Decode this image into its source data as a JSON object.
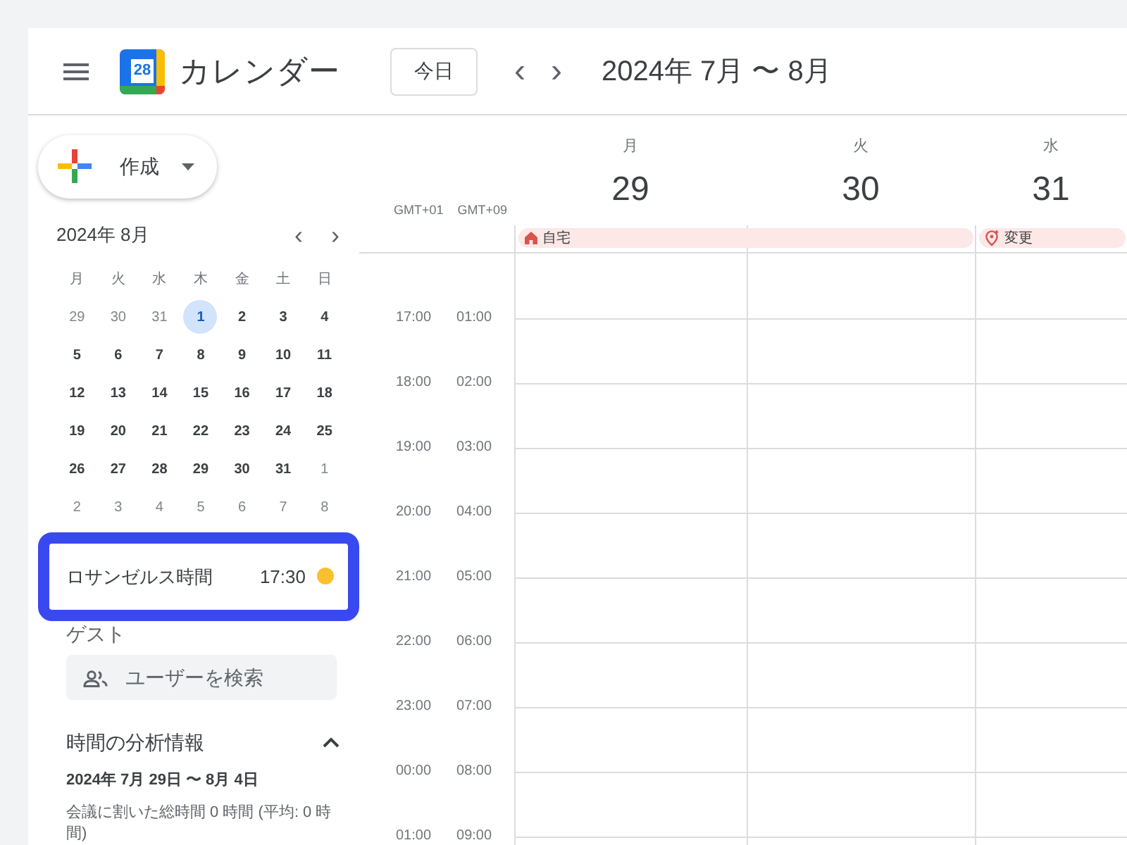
{
  "header": {
    "logo_date": "28",
    "title": "カレンダー",
    "today_button": "今日",
    "prev": "‹",
    "next": "›",
    "date_range": "2024年 7月 〜 8月"
  },
  "create_button": {
    "label": "作成"
  },
  "mini_calendar": {
    "title": "2024年 8月",
    "weekdays": [
      "月",
      "火",
      "水",
      "木",
      "金",
      "土",
      "日"
    ],
    "weeks": [
      [
        {
          "day": "29",
          "muted": true,
          "selected": false
        },
        {
          "day": "30",
          "muted": true,
          "selected": false
        },
        {
          "day": "31",
          "muted": true,
          "selected": false
        },
        {
          "day": "1",
          "muted": false,
          "selected": true
        },
        {
          "day": "2",
          "muted": false,
          "selected": false
        },
        {
          "day": "3",
          "muted": false,
          "selected": false
        },
        {
          "day": "4",
          "muted": false,
          "selected": false
        }
      ],
      [
        {
          "day": "5",
          "muted": false,
          "selected": false
        },
        {
          "day": "6",
          "muted": false,
          "selected": false
        },
        {
          "day": "7",
          "muted": false,
          "selected": false
        },
        {
          "day": "8",
          "muted": false,
          "selected": false
        },
        {
          "day": "9",
          "muted": false,
          "selected": false
        },
        {
          "day": "10",
          "muted": false,
          "selected": false
        },
        {
          "day": "11",
          "muted": false,
          "selected": false
        }
      ],
      [
        {
          "day": "12",
          "muted": false,
          "selected": false
        },
        {
          "day": "13",
          "muted": false,
          "selected": false
        },
        {
          "day": "14",
          "muted": false,
          "selected": false
        },
        {
          "day": "15",
          "muted": false,
          "selected": false
        },
        {
          "day": "16",
          "muted": false,
          "selected": false
        },
        {
          "day": "17",
          "muted": false,
          "selected": false
        },
        {
          "day": "18",
          "muted": false,
          "selected": false
        }
      ],
      [
        {
          "day": "19",
          "muted": false,
          "selected": false
        },
        {
          "day": "20",
          "muted": false,
          "selected": false
        },
        {
          "day": "21",
          "muted": false,
          "selected": false
        },
        {
          "day": "22",
          "muted": false,
          "selected": false
        },
        {
          "day": "23",
          "muted": false,
          "selected": false
        },
        {
          "day": "24",
          "muted": false,
          "selected": false
        },
        {
          "day": "25",
          "muted": false,
          "selected": false
        }
      ],
      [
        {
          "day": "26",
          "muted": false,
          "selected": false
        },
        {
          "day": "27",
          "muted": false,
          "selected": false
        },
        {
          "day": "28",
          "muted": false,
          "selected": false
        },
        {
          "day": "29",
          "muted": false,
          "selected": false
        },
        {
          "day": "30",
          "muted": false,
          "selected": false
        },
        {
          "day": "31",
          "muted": false,
          "selected": false
        },
        {
          "day": "1",
          "muted": true,
          "selected": false
        }
      ],
      [
        {
          "day": "2",
          "muted": true,
          "selected": false
        },
        {
          "day": "3",
          "muted": true,
          "selected": false
        },
        {
          "day": "4",
          "muted": true,
          "selected": false
        },
        {
          "day": "5",
          "muted": true,
          "selected": false
        },
        {
          "day": "6",
          "muted": true,
          "selected": false
        },
        {
          "day": "7",
          "muted": true,
          "selected": false
        },
        {
          "day": "8",
          "muted": true,
          "selected": false
        }
      ]
    ]
  },
  "world_clock": {
    "label": "ロサンゼルス時間",
    "time": "17:30",
    "color": "#fbc02d"
  },
  "guests": {
    "label": "ゲスト",
    "placeholder": "ユーザーを検索"
  },
  "insights": {
    "title": "時間の分析情報",
    "expanded": true,
    "range": "2024年 7月 29日 〜 8月 4日",
    "summary": "会議に割いた総時間 0 時間 (平均: 0 時間)"
  },
  "timezones": [
    "GMT+01",
    "GMT+09"
  ],
  "days": [
    {
      "weekday": "月",
      "date": "29"
    },
    {
      "weekday": "火",
      "date": "30"
    },
    {
      "weekday": "水",
      "date": "31"
    }
  ],
  "all_day_events": [
    {
      "kind": "home",
      "label": "自宅"
    },
    {
      "kind": "pin",
      "label": "変更"
    }
  ],
  "hours": [
    [
      "17:00",
      "01:00"
    ],
    [
      "18:00",
      "02:00"
    ],
    [
      "19:00",
      "03:00"
    ],
    [
      "20:00",
      "04:00"
    ],
    [
      "21:00",
      "05:00"
    ],
    [
      "22:00",
      "06:00"
    ],
    [
      "23:00",
      "07:00"
    ],
    [
      "00:00",
      "08:00"
    ],
    [
      "01:00",
      "09:00"
    ]
  ]
}
